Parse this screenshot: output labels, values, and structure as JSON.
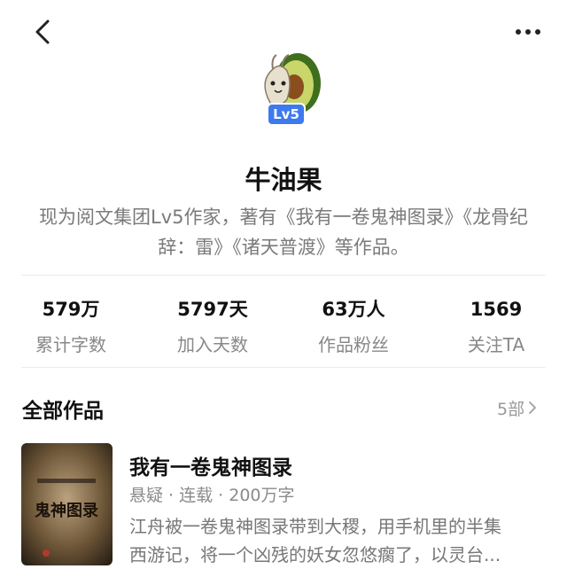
{
  "header": {
    "back_icon": "chevron-left-icon",
    "more_icon": "ellipsis-icon"
  },
  "profile": {
    "avatar_icon": "avocado-avatar",
    "level_badge": "Lv5",
    "badge_color": "#3d7af0",
    "name": "牛油果",
    "intro_line1": "现为阅文集团Lv5作家，著有《我有一卷鬼神图录》《龙骨纪",
    "intro_line2": "辞：雷》《诸天普渡》等作品。"
  },
  "stats": [
    {
      "value": "579万",
      "label": "累计字数"
    },
    {
      "value": "5797天",
      "label": "加入天数"
    },
    {
      "value": "63万人",
      "label": "作品粉丝"
    },
    {
      "value": "1569",
      "label": "关注TA"
    }
  ],
  "works": {
    "title": "全部作品",
    "count": "5部",
    "count_icon": "chevron-right-icon",
    "items": [
      {
        "title": "我有一卷鬼神图录",
        "meta": "悬疑 · 连载 · 200万字",
        "desc_line1": "江舟被一卷鬼神图录带到大稷，用手机里的半集",
        "desc_line2": "西游记，将一个凶残的妖女忽悠瘸了，以灵台...",
        "cover_text": "鬼神图录"
      }
    ]
  }
}
